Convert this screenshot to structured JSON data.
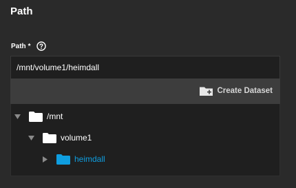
{
  "section": {
    "title": "Path"
  },
  "field": {
    "label": "Path",
    "required_marker": "*",
    "value": "/mnt/volume1/heimdall"
  },
  "toolbar": {
    "create_dataset_label": "Create Dataset"
  },
  "tree": {
    "nodes": [
      {
        "label": "/mnt",
        "expanded": true,
        "selected": false,
        "toggle_icon": "caret-down-icon",
        "icon": "folder-icon",
        "icon_color": "#ffffff"
      },
      {
        "label": "volume1",
        "expanded": true,
        "selected": false,
        "toggle_icon": "caret-down-icon",
        "icon": "folder-icon",
        "icon_color": "#ffffff"
      },
      {
        "label": "heimdall",
        "expanded": false,
        "selected": true,
        "toggle_icon": "caret-right-icon",
        "icon": "folder-icon",
        "icon_color": "#0f9ee0"
      }
    ]
  },
  "colors": {
    "background": "#2a2a2a",
    "input_background": "#1f1f1f",
    "toolbar_background": "#3d3d3d",
    "accent": "#0f9ee0"
  }
}
